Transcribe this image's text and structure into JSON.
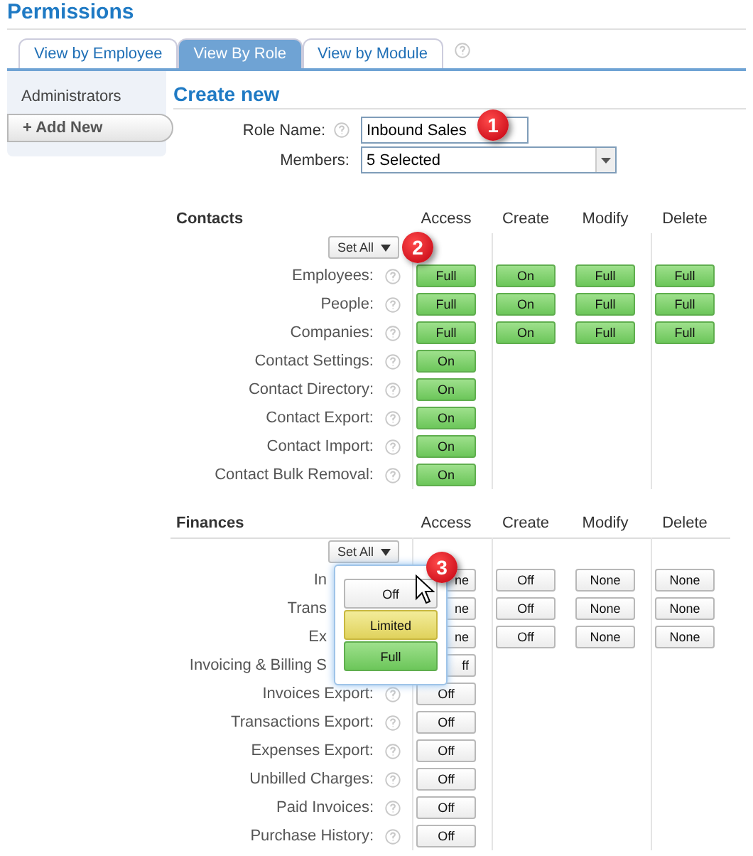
{
  "title": "Permissions",
  "tabs": [
    {
      "label": "View by Employee",
      "selected": false
    },
    {
      "label": "View By Role",
      "selected": true
    },
    {
      "label": "View by Module",
      "selected": false
    }
  ],
  "sidebar": {
    "items": [
      {
        "label": "Administrators"
      }
    ],
    "add_button": "+ Add New"
  },
  "form": {
    "heading": "Create new",
    "role_name": {
      "label": "Role Name:",
      "value": "Inbound Sales"
    },
    "members": {
      "label": "Members:",
      "value": "5 Selected"
    }
  },
  "sections": [
    {
      "title": "Contacts",
      "columns": [
        "Access",
        "Create",
        "Modify",
        "Delete"
      ],
      "set_all": "Set All",
      "underline": false,
      "rows": [
        {
          "label": "Employees:",
          "covered": false,
          "cells": [
            {
              "text": "Full",
              "kind": "full"
            },
            {
              "text": "On",
              "kind": "on"
            },
            {
              "text": "Full",
              "kind": "full"
            },
            {
              "text": "Full",
              "kind": "full"
            }
          ]
        },
        {
          "label": "People:",
          "covered": false,
          "cells": [
            {
              "text": "Full",
              "kind": "full"
            },
            {
              "text": "On",
              "kind": "on"
            },
            {
              "text": "Full",
              "kind": "full"
            },
            {
              "text": "Full",
              "kind": "full"
            }
          ]
        },
        {
          "label": "Companies:",
          "covered": false,
          "cells": [
            {
              "text": "Full",
              "kind": "full"
            },
            {
              "text": "On",
              "kind": "on"
            },
            {
              "text": "Full",
              "kind": "full"
            },
            {
              "text": "Full",
              "kind": "full"
            }
          ]
        },
        {
          "label": "Contact Settings:",
          "covered": false,
          "cells": [
            {
              "text": "On",
              "kind": "on"
            }
          ]
        },
        {
          "label": "Contact Directory:",
          "covered": false,
          "cells": [
            {
              "text": "On",
              "kind": "on"
            }
          ]
        },
        {
          "label": "Contact Export:",
          "covered": false,
          "cells": [
            {
              "text": "On",
              "kind": "on"
            }
          ]
        },
        {
          "label": "Contact Import:",
          "covered": false,
          "cells": [
            {
              "text": "On",
              "kind": "on"
            }
          ]
        },
        {
          "label": "Contact Bulk Removal:",
          "covered": false,
          "cells": [
            {
              "text": "On",
              "kind": "on"
            }
          ]
        }
      ]
    },
    {
      "title": "Finances",
      "columns": [
        "Access",
        "Create",
        "Modify",
        "Delete"
      ],
      "set_all": "Set All",
      "underline": true,
      "rows": [
        {
          "label": "In",
          "covered": true,
          "cells": [
            {
              "text": "ne",
              "kind": "none"
            },
            {
              "text": "Off",
              "kind": "off"
            },
            {
              "text": "None",
              "kind": "none"
            },
            {
              "text": "None",
              "kind": "none"
            }
          ]
        },
        {
          "label": "Trans",
          "covered": true,
          "cells": [
            {
              "text": "ne",
              "kind": "none"
            },
            {
              "text": "Off",
              "kind": "off"
            },
            {
              "text": "None",
              "kind": "none"
            },
            {
              "text": "None",
              "kind": "none"
            }
          ]
        },
        {
          "label": "Ex",
          "covered": true,
          "cells": [
            {
              "text": "ne",
              "kind": "none"
            },
            {
              "text": "Off",
              "kind": "off"
            },
            {
              "text": "None",
              "kind": "none"
            },
            {
              "text": "None",
              "kind": "none"
            }
          ]
        },
        {
          "label": "Invoicing & Billing S",
          "covered": true,
          "cells": [
            {
              "text": "ff",
              "kind": "off"
            }
          ]
        },
        {
          "label": "Invoices Export:",
          "covered": false,
          "cells": [
            {
              "text": "Off",
              "kind": "off"
            }
          ]
        },
        {
          "label": "Transactions Export:",
          "covered": false,
          "cells": [
            {
              "text": "Off",
              "kind": "off"
            }
          ]
        },
        {
          "label": "Expenses Export:",
          "covered": false,
          "cells": [
            {
              "text": "Off",
              "kind": "off"
            }
          ]
        },
        {
          "label": "Unbilled Charges:",
          "covered": false,
          "cells": [
            {
              "text": "Off",
              "kind": "off"
            }
          ]
        },
        {
          "label": "Paid Invoices:",
          "covered": false,
          "cells": [
            {
              "text": "Off",
              "kind": "off"
            }
          ]
        },
        {
          "label": "Purchase History:",
          "covered": false,
          "cells": [
            {
              "text": "Off",
              "kind": "off"
            }
          ]
        }
      ]
    }
  ],
  "popup": {
    "options": [
      {
        "text": "Off",
        "kind": "off"
      },
      {
        "text": "Limited",
        "kind": "limited"
      },
      {
        "text": "Full",
        "kind": "full"
      }
    ]
  },
  "callouts": [
    "1",
    "2",
    "3"
  ]
}
